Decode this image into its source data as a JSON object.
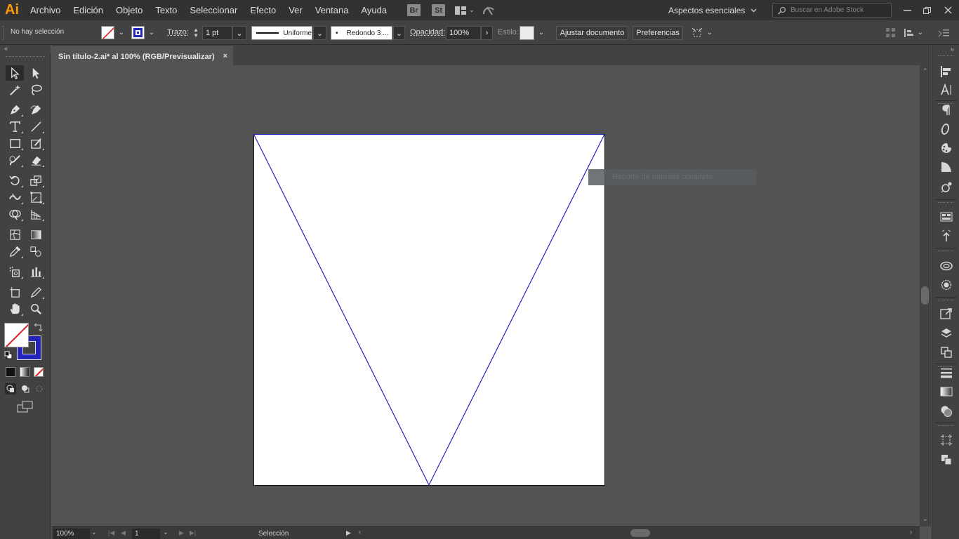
{
  "app": {
    "logo": "Ai",
    "accent": "#ff9a00"
  },
  "menu": [
    "Archivo",
    "Edición",
    "Objeto",
    "Texto",
    "Seleccionar",
    "Efecto",
    "Ver",
    "Ventana",
    "Ayuda"
  ],
  "bridge": {
    "br": "Br",
    "st": "St"
  },
  "workspace": {
    "label": "Aspectos esenciales"
  },
  "search": {
    "placeholder": "Buscar en Adobe Stock"
  },
  "control": {
    "selection_status": "No hay selección",
    "stroke_label": "Trazo:",
    "stroke_weight": "1 pt",
    "stroke_profile": "Uniforme",
    "brush": "Redondo 3 ...",
    "brush_dot": "•",
    "opacity_label": "Opacidad:",
    "opacity_value": "100%",
    "style_label": "Estilo:",
    "fit_doc_button": "Ajustar documento",
    "prefs_button": "Preferencias",
    "stroke_color": "#2324b8"
  },
  "document": {
    "tab_title": "Sin título-2.ai* al 100% (RGB/Previsualizar)",
    "tab_close": "×"
  },
  "status": {
    "zoom": "100%",
    "artboard_num": "1",
    "tool_name": "Selección"
  },
  "tooltip": {
    "text": "Recorte de pantalla completa"
  },
  "colors": {
    "stroke": "#2324b8",
    "fill": "none"
  }
}
